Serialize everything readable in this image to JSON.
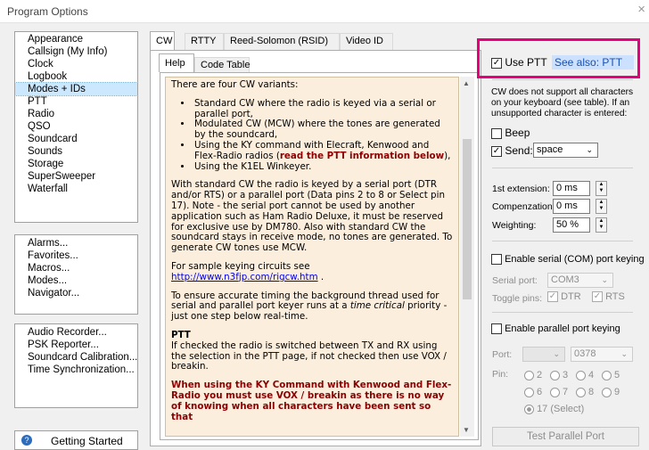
{
  "window": {
    "title": "Program Options",
    "close": "×"
  },
  "nav1": [
    "Appearance",
    "Callsign (My Info)",
    "Clock",
    "Logbook",
    "Modes + IDs",
    "PTT",
    "Radio",
    "QSO",
    "Soundcard",
    "Sounds",
    "Storage",
    "SuperSweeper",
    "Waterfall"
  ],
  "nav1_selected": "Modes + IDs",
  "nav2": [
    "Alarms...",
    "Favorites...",
    "Macros...",
    "Modes...",
    "Navigator..."
  ],
  "nav3": [
    "Audio Recorder...",
    "PSK Reporter...",
    "Soundcard Calibration...",
    "Time Synchronization..."
  ],
  "getting_started": "Getting Started",
  "tabs": [
    "CW",
    "RTTY",
    "Reed-Solomon (RSID)",
    "Video ID"
  ],
  "subtabs": [
    "Help",
    "Code Table"
  ],
  "help": {
    "p1": "There are four CW variants:",
    "b1": "Standard CW where the radio is keyed via a serial or parallel port,",
    "b2": "Modulated CW (MCW) where the tones are generated by the soundcard,",
    "b3a": "Using the KY command with Elecraft, Kenwood and Flex-Radio radios (",
    "b3b": "read the PTT information below",
    "b3c": "),",
    "b4": "Using the K1EL Winkeyer.",
    "p2": "With standard CW the radio is keyed by a serial port (DTR and/or RTS) or a parallel port (Data pins 2 to 8 or Select pin 17). Note - the serial port cannot be used by another application such as Ham Radio Deluxe, it must be reserved for exclusive use by DM780. Also with standard CW the soundcard stays in receive mode, no tones are generated. To generate CW tones use MCW.",
    "p3": "For sample keying circuits see",
    "p3link": "http://www.n3fjp.com/rigcw.htm",
    "p3end": " .",
    "p4a": "To ensure accurate timing the background thread used for serial and parallel port keyer runs at a ",
    "p4b": "time critical",
    "p4c": " priority - just one step below real-time.",
    "ptt_head": "PTT",
    "p5": "If checked the radio is switched between TX and RX using the selection in the PTT page, if not checked then use VOX / breakin.",
    "p6": "When using the KY Command with Kenwood and Flex-Radio you must use VOX / breakin as there is no way of knowing when all characters have been sent so that"
  },
  "right": {
    "use_ptt": "Use PTT",
    "see_also": "See also: PTT",
    "note": "CW does not support all characters on your keyboard (see table). If an unsupported character  is entered:",
    "beep": "Beep",
    "send": "Send:",
    "send_value": "space",
    "ext_label": "1st extension:",
    "ext_value": "0 ms",
    "comp_label": "Compenzation:",
    "comp_value": "0 ms",
    "weight_label": "Weighting:",
    "weight_value": "50 %",
    "serial_label": "Enable serial (COM) port keying",
    "serial_port_label": "Serial port:",
    "serial_port_value": "COM3",
    "toggle_label": "Toggle pins:",
    "dtr": "DTR",
    "rts": "RTS",
    "parallel_label": "Enable parallel port keying",
    "port_label": "Port:",
    "port_value": "0378",
    "pin_label": "Pin:",
    "pins": [
      "2",
      "3",
      "4",
      "5",
      "6",
      "7",
      "8",
      "9"
    ],
    "pin17": "17 (Select)",
    "test_btn": "Test Parallel Port"
  }
}
